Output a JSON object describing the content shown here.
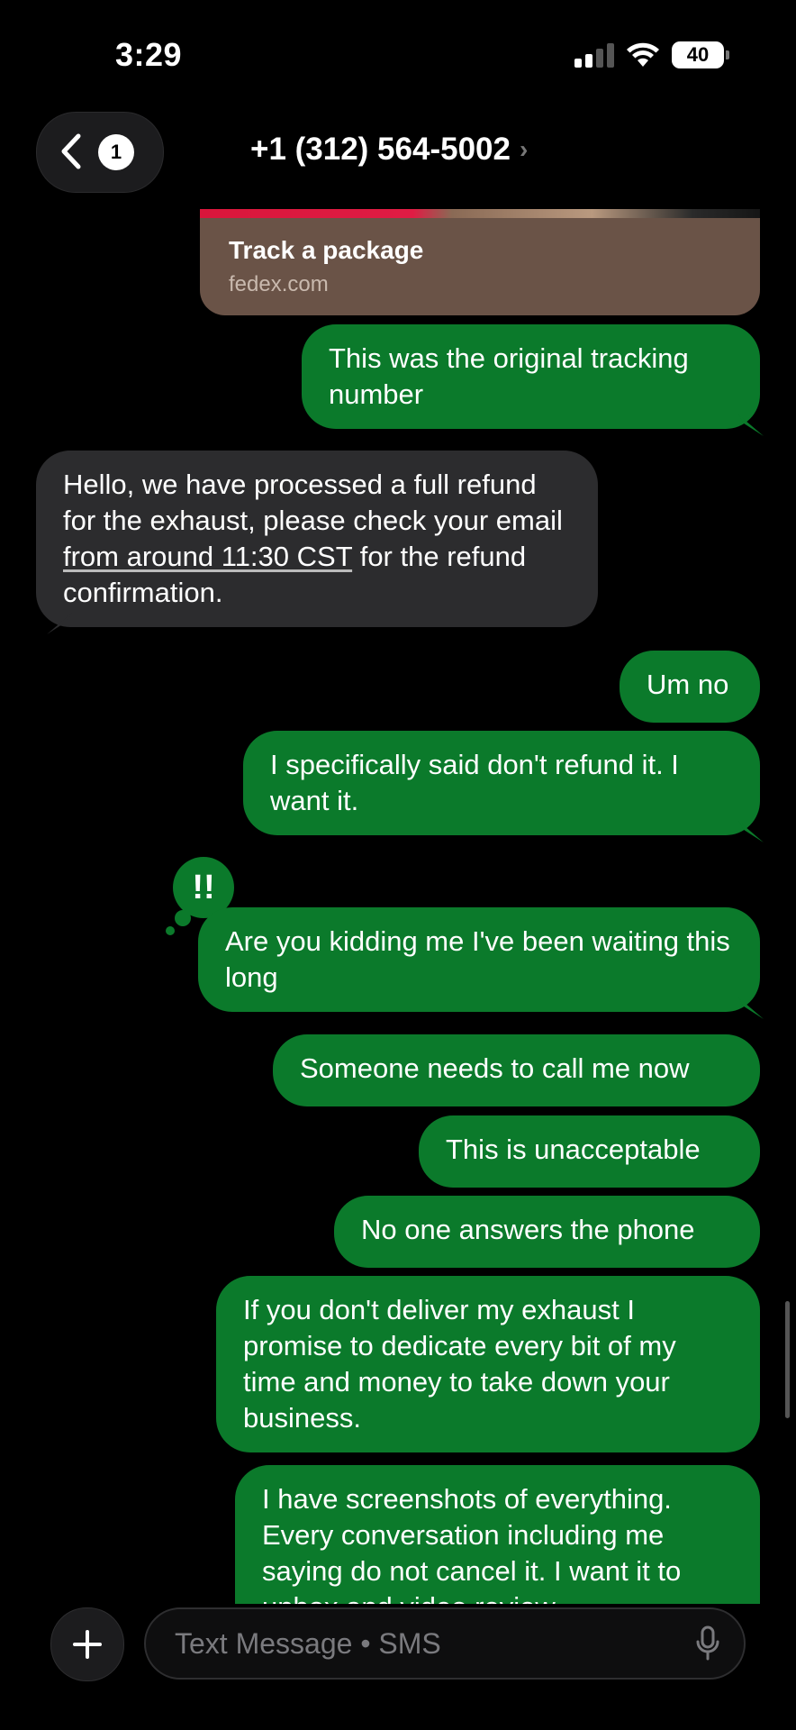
{
  "status_bar": {
    "time": "3:29",
    "battery": "40"
  },
  "nav": {
    "back_count": "1",
    "contact": "+1 (312) 564-5002",
    "contact_chevron": "›"
  },
  "link_preview": {
    "title": "Track a package",
    "domain": "fedex.com"
  },
  "messages": {
    "m1": "This was the original tracking number",
    "m2_pre": "Hello, we have processed a full refund for the exhaust, please check your email ",
    "m2_link": "from around 11:30 CST",
    "m2_post": " for the refund confirmation.",
    "m3": "Um no",
    "m4": "I specifically said don't refund it. I want it.",
    "m5": "Are you kidding me I've been waiting this long",
    "m6": "Someone needs to call me now",
    "m7": "This is unacceptable",
    "m8": "No one answers the phone",
    "m9": "If you don't deliver my exhaust I promise to dedicate every bit of my time and money to take down your business.",
    "m10": "I have screenshots of everything. Every conversation including me saying do not cancel it. I want it to unbox and video review"
  },
  "tapback": {
    "glyph": "!!"
  },
  "composer": {
    "placeholder": "Text Message • SMS"
  },
  "colors": {
    "sent": "#0b7a2b",
    "received": "#2c2c2e",
    "background": "#000000"
  }
}
